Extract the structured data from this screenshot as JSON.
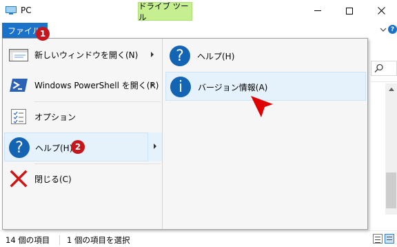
{
  "window": {
    "title": "PC",
    "context_tab": "ドライブ ツール"
  },
  "ribbon": {
    "file_tab": "ファイル",
    "help_glyph": "?"
  },
  "file_menu": {
    "items": [
      {
        "label": "新しいウィンドウを開く(N)",
        "icon": "new-window-icon",
        "has_submenu": true
      },
      {
        "label": "Windows PowerShell を開く(R)",
        "icon": "powershell-icon",
        "has_submenu": true
      },
      {
        "label": "オプション",
        "icon": "options-icon",
        "has_submenu": false
      },
      {
        "label": "ヘルプ(H)",
        "icon": "help-icon",
        "glyph": "?",
        "has_submenu": true
      },
      {
        "label": "閉じる(C)",
        "icon": "close-x-icon",
        "has_submenu": false
      }
    ],
    "submenu": [
      {
        "label": "ヘルプ(H)",
        "icon": "help-icon",
        "glyph": "?"
      },
      {
        "label": "バージョン情報(A)",
        "icon": "info-icon",
        "glyph": "i"
      }
    ]
  },
  "annotations": {
    "badge1": "1",
    "badge2": "2"
  },
  "statusbar": {
    "item_count": "14 個の項目",
    "selection": "1 個の項目を選択"
  },
  "colors": {
    "accent": "#1a73c8",
    "context_tab": "#c6ef8f",
    "badge": "#c4161c",
    "menu_highlight": "#e5f1fb",
    "pointer": "#e00000"
  }
}
